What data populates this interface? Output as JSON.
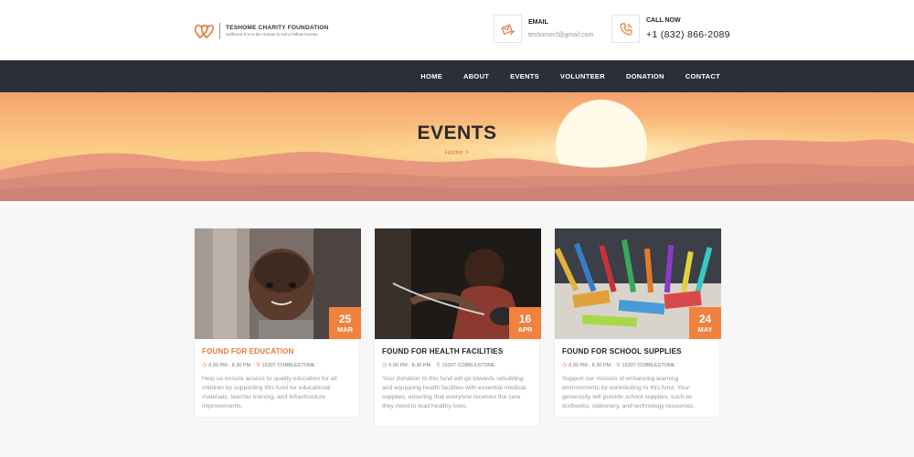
{
  "header": {
    "logo_name": "TESHOME CHARITY FOUNDATION",
    "logo_tagline": "Sufficient It Is to Be Human to Aid a Fellow Human",
    "email_label": "EMAIL",
    "email_value": "teshomecf@gmail.com",
    "phone_label": "CALL NOW",
    "phone_value": "+1 (832) 866-2089"
  },
  "nav": {
    "items": [
      {
        "label": "HOME"
      },
      {
        "label": "ABOUT"
      },
      {
        "label": "EVENTS"
      },
      {
        "label": "VOLUNTEER"
      },
      {
        "label": "DONATION"
      },
      {
        "label": "CONTACT"
      }
    ]
  },
  "hero": {
    "title": "EVENTS",
    "breadcrumb": "Home >"
  },
  "events": [
    {
      "title": "FOUND FOR EDUCATION",
      "day": "25",
      "month": "MAR",
      "time": "6.00 PM - 8.30 PM",
      "location": "15307 COBBLESTONE",
      "description": "Help us ensure access to quality education for all children by supporting this fund for educational materials, teacher training, and infrastructure improvements."
    },
    {
      "title": "FOUND FOR HEALTH FACILITIES",
      "day": "16",
      "month": "APR",
      "time": "6.00 PM - 8.30 PM",
      "location": "15307 COBBLESTONE",
      "description": "Your donation to this fund will go towards rebuilding and equipping health facilities with essential medical supplies, ensuring that everyone receives the care they need to lead healthy lives."
    },
    {
      "title": "FOUND FOR SCHOOL SUPPLIES",
      "day": "24",
      "month": "MAY",
      "time": "6.00 PM - 8.30 PM",
      "location": "15307 COBBLESTONE",
      "description": "Support our mission of enhancing learning environments by contributing to this fund. Your generosity will provide school supplies, such as textbooks, stationery, and technology resources."
    }
  ],
  "colors": {
    "accent": "#f0813e",
    "nav_bg": "#2b3038",
    "page_bg": "#f7f7f8"
  },
  "icons": {
    "email": "email-edit-icon",
    "phone": "phone-call-icon",
    "time": "clock-icon",
    "location": "map-pin-icon"
  }
}
